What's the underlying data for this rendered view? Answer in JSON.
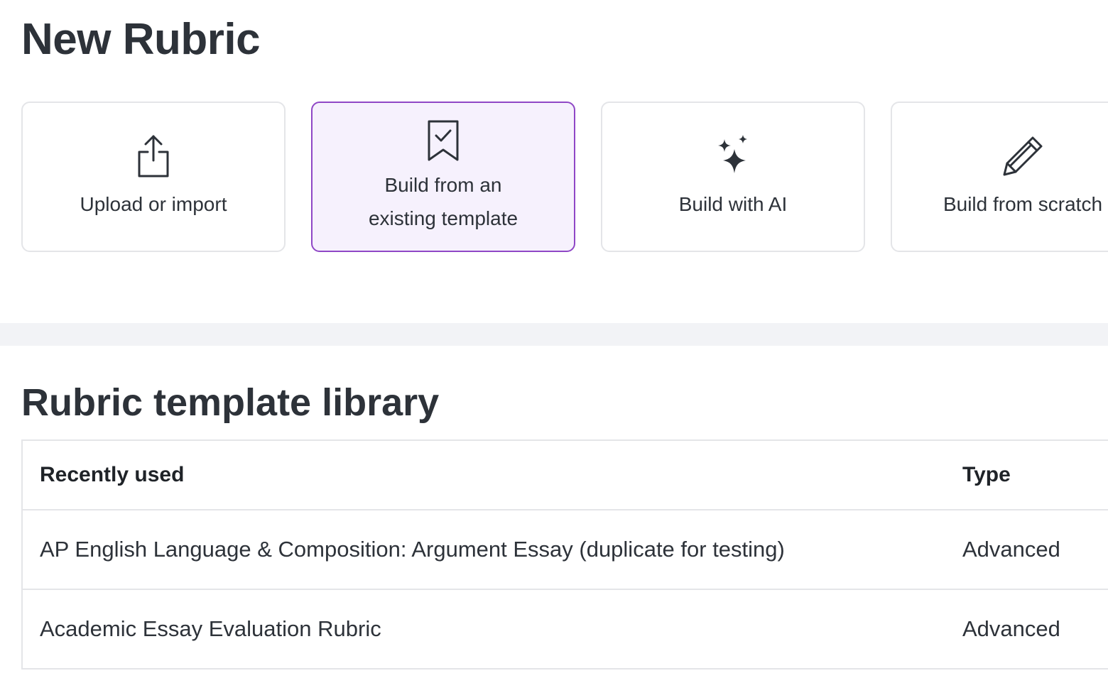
{
  "page": {
    "title": "New Rubric"
  },
  "options": [
    {
      "label": "Upload or import",
      "icon": "upload-share-icon",
      "selected": false
    },
    {
      "label": "Build from an\nexisting template",
      "icon": "bookmark-check-icon",
      "selected": true
    },
    {
      "label": "Build with AI",
      "icon": "sparkles-icon",
      "selected": false
    },
    {
      "label": "Build from scratch",
      "icon": "pencil-icon",
      "selected": false
    }
  ],
  "library": {
    "title": "Rubric template library",
    "columns": {
      "name": "Recently used",
      "type": "Type"
    },
    "rows": [
      {
        "name": "AP English Language & Composition: Argument Essay (duplicate for testing)",
        "type": "Advanced"
      },
      {
        "name": "Academic Essay Evaluation Rubric",
        "type": "Advanced"
      }
    ]
  },
  "colors": {
    "accent": "#8f47c6",
    "selected_background": "#f6f1fd",
    "text": "#2d3239",
    "border": "#e4e5e8",
    "divider_band": "#f2f3f6"
  }
}
